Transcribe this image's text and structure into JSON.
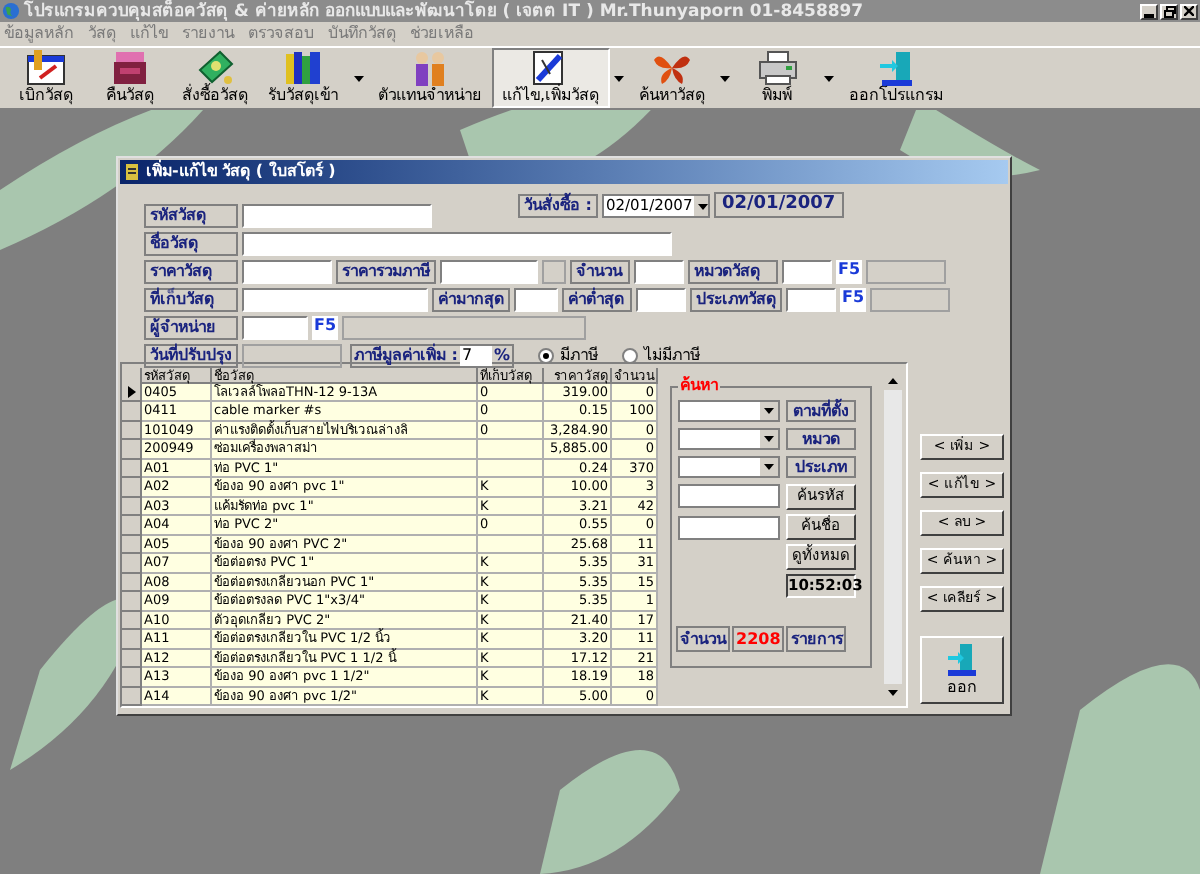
{
  "window": {
    "title": "โปรแกรมควบคุมสต็อควัสดุ & ค่ายหลัก ออกแบบและพัฒนาโดย ( เจตต IT ) Mr.Thunyaporn 01-8458897"
  },
  "menu": [
    {
      "label": "ข้อมูลหลัก"
    },
    {
      "label": "วัสดุ"
    },
    {
      "label": "แก้ไข"
    },
    {
      "label": "รายงาน"
    },
    {
      "label": "ตรวจสอบ"
    },
    {
      "label": "บันทึกวัสดุ"
    },
    {
      "label": "ช่วยเหลือ"
    }
  ],
  "toolbar": [
    {
      "kind": "form",
      "label": "เบิกวัสดุ",
      "selected": false,
      "dropdown": false
    },
    {
      "kind": "box",
      "label": "คืนวัสดุ",
      "selected": false,
      "dropdown": false
    },
    {
      "kind": "money",
      "label": "สั่งซื้อวัสดุ",
      "selected": false,
      "dropdown": false
    },
    {
      "kind": "books",
      "label": "รับวัสดุเข้า",
      "selected": false,
      "dropdown": true
    },
    {
      "kind": "people",
      "label": "ตัวแทนจำหน่าย",
      "selected": false,
      "dropdown": false
    },
    {
      "kind": "edit",
      "label": "แก้ไข,เพิ่มวัสดุ",
      "selected": true,
      "dropdown": true
    },
    {
      "kind": "butterfly",
      "label": "ค้นหาวัสดุ",
      "selected": false,
      "dropdown": true
    },
    {
      "kind": "printer",
      "label": "พิมพ์",
      "selected": false,
      "dropdown": true
    },
    {
      "kind": "exit",
      "label": "ออกโปรแกรม",
      "selected": false,
      "dropdown": false
    }
  ],
  "dialog": {
    "title": "เพิ่ม-แก้ไข วัสดุ ( ใบสโตร์ )",
    "order_date": {
      "label": "วันสั่งซื้อ :",
      "value": "02/01/2007",
      "display": "02/01/2007"
    },
    "form_rows": [
      [
        {
          "kind": "label",
          "text": "รหัสวัสดุ"
        },
        {
          "kind": "input"
        }
      ],
      [
        {
          "kind": "label",
          "text": "ชื่อวัสดุ"
        },
        {
          "kind": "input"
        }
      ],
      [
        {
          "kind": "label",
          "text": "ราคาวัสดุ"
        },
        {
          "kind": "input"
        },
        {
          "kind": "label",
          "text": "ราคารวมภาษี"
        },
        {
          "kind": "input"
        },
        {
          "kind": "blank"
        },
        {
          "kind": "label",
          "text": "จำนวน"
        },
        {
          "kind": "input"
        },
        {
          "kind": "label",
          "text": "หมวดวัสดุ"
        },
        {
          "kind": "input"
        },
        {
          "kind": "key",
          "text": "F5"
        },
        {
          "kind": "blank"
        }
      ],
      [
        {
          "kind": "label",
          "text": "ที่เก็บวัสดุ"
        },
        {
          "kind": "input"
        },
        {
          "kind": "label",
          "text": "ค่ามากสุด"
        },
        {
          "kind": "input"
        },
        {
          "kind": "label",
          "text": "ค่าต่ำสุด"
        },
        {
          "kind": "input"
        },
        {
          "kind": "label",
          "text": "ประเภทวัสดุ"
        },
        {
          "kind": "input"
        },
        {
          "kind": "key",
          "text": "F5"
        },
        {
          "kind": "blank"
        }
      ],
      [
        {
          "kind": "label",
          "text": "ผู้จำหน่าย"
        },
        {
          "kind": "input"
        },
        {
          "kind": "key",
          "text": "F5"
        },
        {
          "kind": "blank"
        }
      ],
      [
        {
          "kind": "label",
          "text": "วันที่ปรับปรุง"
        },
        {
          "kind": "blank"
        }
      ]
    ],
    "vat": {
      "label": "ภาษีมูลค่าเพิ่ม :",
      "value": "7",
      "unit": "%"
    },
    "tax_options": [
      {
        "label": "มีภาษี",
        "selected": true
      },
      {
        "label": "ไม่มีภาษี",
        "selected": false
      }
    ],
    "table": {
      "columns": [
        "รหัสวัสดุ",
        "ชื่อวัสดุ",
        "ที่เก็บวัสดุ",
        "ราคาวัสดุ",
        "จำนวน"
      ],
      "rows": [
        {
          "selected": true,
          "cells": [
            "0405",
            "โลเวลล์โพลอTHN-12  9-13A",
            "0",
            "319.00",
            "0"
          ]
        },
        {
          "selected": false,
          "cells": [
            "0411",
            "cable marker #s",
            "0",
            "0.15",
            "100"
          ]
        },
        {
          "selected": false,
          "cells": [
            "101049",
            "ค่าแรงติดตั้งเก็บสายไฟบริเวณล่างลิ",
            "0",
            "3,284.90",
            "0"
          ]
        },
        {
          "selected": false,
          "cells": [
            "200949",
            "ซ่อมเครื่องพลาสม่า",
            null,
            "5,885.00",
            "0"
          ]
        },
        {
          "selected": false,
          "cells": [
            "A01",
            "ท่อ PVC 1\"",
            null,
            "0.24",
            "370"
          ]
        },
        {
          "selected": false,
          "cells": [
            "A02",
            "ข้องอ 90 องศา pvc 1\"",
            "K",
            "10.00",
            "3"
          ]
        },
        {
          "selected": false,
          "cells": [
            "A03",
            "แค้มรัดท่อ pvc 1\"",
            "K",
            "3.21",
            "42"
          ]
        },
        {
          "selected": false,
          "cells": [
            "A04",
            "ท่อ PVC 2\"",
            "0",
            "0.55",
            "0"
          ]
        },
        {
          "selected": false,
          "cells": [
            "A05",
            "ข้องอ 90 องศา PVC 2\"",
            null,
            "25.68",
            "11"
          ]
        },
        {
          "selected": false,
          "cells": [
            "A07",
            "ข้อต่อตรง  PVC  1\"",
            "K",
            "5.35",
            "31"
          ]
        },
        {
          "selected": false,
          "cells": [
            "A08",
            "ข้อต่อตรงเกลียวนอก  PVC  1\"",
            "K",
            "5.35",
            "15"
          ]
        },
        {
          "selected": false,
          "cells": [
            "A09",
            "ข้อต่อตรงลด  PVC  1\"x3/4\"",
            "K",
            "5.35",
            "1"
          ]
        },
        {
          "selected": false,
          "cells": [
            "A10",
            "ตัวอุดเกลียว  PVC  2\"",
            "K",
            "21.40",
            "17"
          ]
        },
        {
          "selected": false,
          "cells": [
            "A11",
            "ข้อต่อตรงเกลียวใน  PVC 1/2  นิ้ว",
            "K",
            "3.20",
            "11"
          ]
        },
        {
          "selected": false,
          "cells": [
            "A12",
            "ข้อต่อตรงเกลียวใน  PVC   1 1/2  นิ้",
            "K",
            "17.12",
            "21"
          ]
        },
        {
          "selected": false,
          "cells": [
            "A13",
            "ข้องอ 90 องศา  pvc  1  1/2\"",
            "K",
            "18.19",
            "18"
          ]
        },
        {
          "selected": false,
          "cells": [
            "A14",
            "ข้องอ 90 องศา  pvc  1/2\"",
            "K",
            "5.00",
            "0"
          ]
        }
      ]
    },
    "search": {
      "title": "ค้นหา",
      "dropdown_buttons": [
        "ตามที่ตั้ง",
        "หมวด",
        "ประเภท"
      ],
      "buttons": [
        "ค้นรหัส",
        "ค้นชื่อ",
        "ดูทั้งหมด"
      ],
      "time": "10:52:03",
      "count_label": "จำนวน",
      "count": "2208",
      "count_unit": "รายการ"
    },
    "actions": [
      "< เพิ่ม >",
      "< แก้ไข >",
      "< ลบ >",
      "< ค้นหา >",
      "< เคลียร์ >"
    ],
    "exit_button": "ออก"
  }
}
